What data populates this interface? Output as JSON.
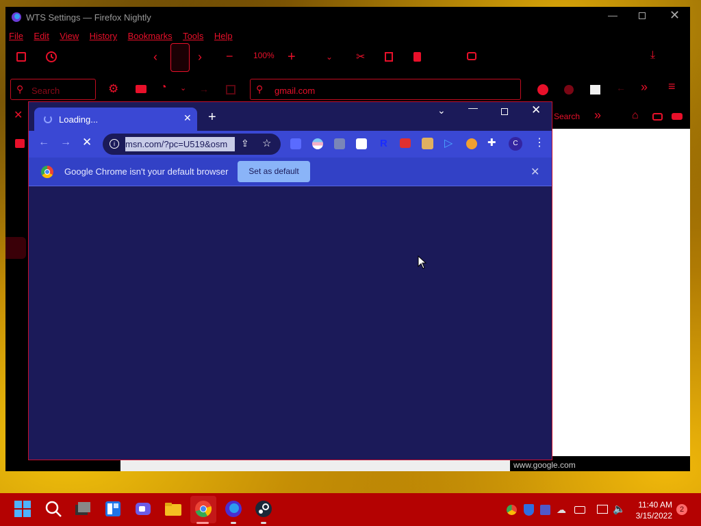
{
  "firefox": {
    "title": "WTS Settings — Firefox Nightly",
    "menu": [
      "File",
      "Edit",
      "View",
      "History",
      "Bookmarks",
      "Tools",
      "Help"
    ],
    "zoom": "100%",
    "search_placeholder": "Search",
    "url": "gmail.com",
    "sidebar_search": "Search",
    "status_url": "www.google.com"
  },
  "chrome": {
    "tab_title": "Loading...",
    "address": "msn.com/?pc=U519&osm",
    "avatar_letter": "C",
    "ext_letter": "R",
    "infobar_text": "Google Chrome isn't your default browser",
    "set_default_label": "Set as default"
  },
  "taskbar": {
    "time": "11:40 AM",
    "date": "3/15/2022",
    "notification_count": "2"
  },
  "colors": {
    "accent_red": "#e8102a",
    "chrome_bg": "#1b1a59",
    "chrome_toolbar": "#2b36a8",
    "taskbar": "#b40202"
  }
}
